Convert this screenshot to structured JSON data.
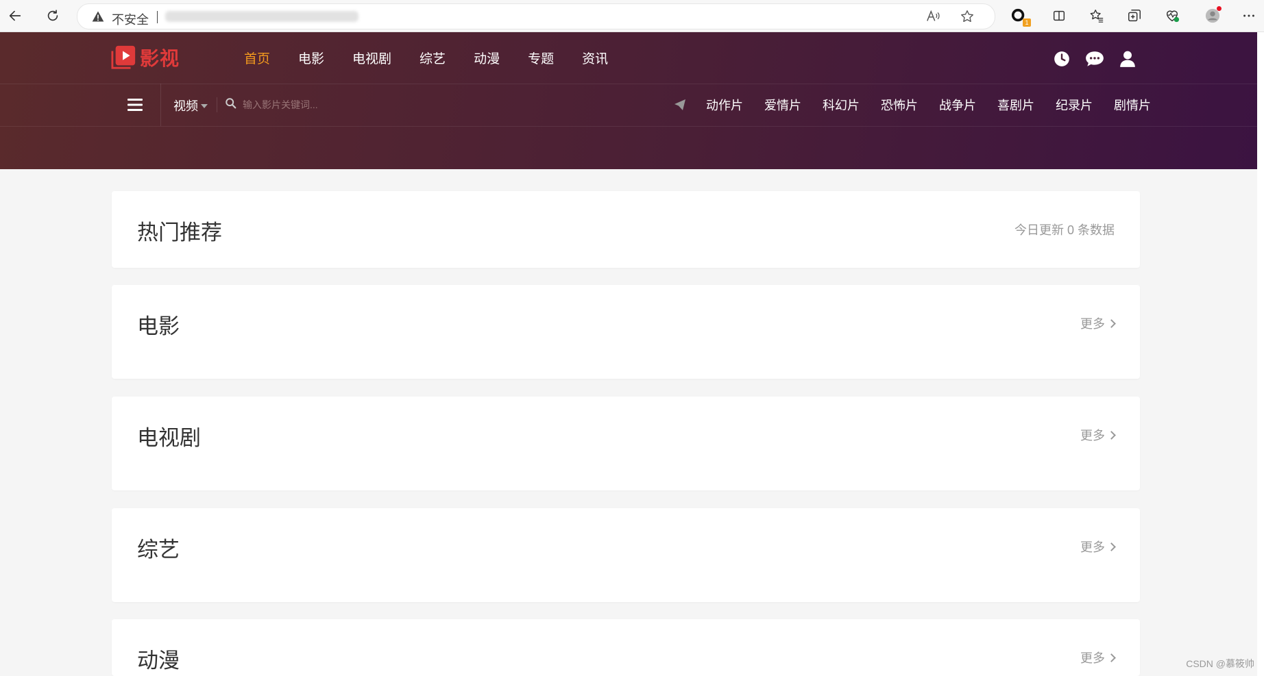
{
  "browser": {
    "insecure_label": "不安全",
    "extension_badge": "1"
  },
  "site": {
    "logo_text": "影视",
    "nav": [
      "首页",
      "电影",
      "电视剧",
      "综艺",
      "动漫",
      "专题",
      "资讯"
    ],
    "active_nav_index": 0,
    "search": {
      "type_label": "视频",
      "placeholder": "输入影片关键词..."
    },
    "genres": [
      "动作片",
      "爱情片",
      "科幻片",
      "恐怖片",
      "战争片",
      "喜剧片",
      "纪录片",
      "剧情片"
    ]
  },
  "sections": [
    {
      "title": "热门推荐",
      "meta": "今日更新 0 条数据"
    },
    {
      "title": "电影",
      "more_label": "更多"
    },
    {
      "title": "电视剧",
      "more_label": "更多"
    },
    {
      "title": "综艺",
      "more_label": "更多"
    },
    {
      "title": "动漫",
      "more_label": "更多"
    }
  ],
  "watermark": "CSDN @慕筱帅",
  "colors": {
    "header_start": "#5a2a2c",
    "header_end": "#3b1341",
    "accent": "#f39a1e",
    "logo": "#e03a3a"
  }
}
